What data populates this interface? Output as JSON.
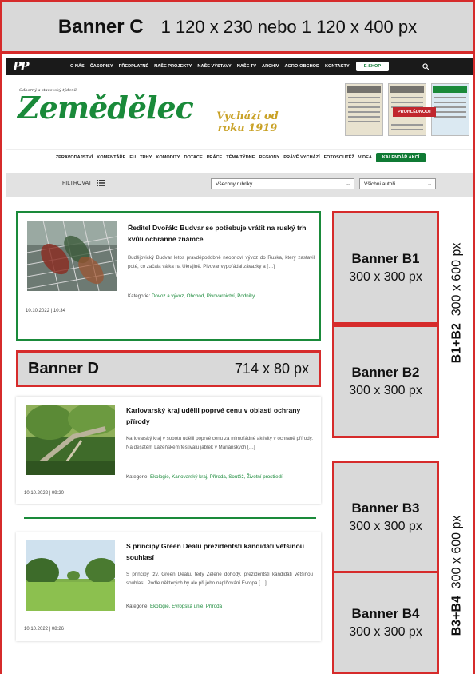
{
  "banners": {
    "c": {
      "name": "Banner C",
      "size": "1 120 x 230 nebo 1 120 x 400 px"
    },
    "d": {
      "name": "Banner D",
      "size": "714 x 80 px"
    },
    "b1": {
      "name": "Banner B1",
      "size": "300 x 300 px"
    },
    "b2": {
      "name": "Banner B2",
      "size": "300 x 300 px"
    },
    "b3": {
      "name": "Banner B3",
      "size": "300 x 300 px"
    },
    "b4": {
      "name": "Banner B4",
      "size": "300 x 300 px"
    },
    "b12_label": {
      "name": "B1+B2",
      "size": "300 x 600 px"
    },
    "b34_label": {
      "name": "B3+B4",
      "size": "300 x 600 px"
    }
  },
  "topbar": {
    "logo": "PP",
    "nav": [
      "O NÁS",
      "ČASOPISY",
      "PŘEDPLATNÉ",
      "NAŠE PROJEKTY",
      "NAŠE VÝSTAVY",
      "NAŠE TV",
      "ARCHIV",
      "AGRO-OBCHOD",
      "KONTAKTY"
    ],
    "eshop": "E-SHOP"
  },
  "header": {
    "tagline": "Odborný a stavovský týdeník",
    "brand": "Zemědělec",
    "since": "Vychází od roku 1919",
    "prohlednout": "PROHLÉDNOUT"
  },
  "mainnav": {
    "items": [
      "ZPRAVODAJSTVÍ",
      "KOMENTÁŘE",
      "EU",
      "TRHY",
      "KOMODITY",
      "DOTACE",
      "PRÁCE",
      "TÉMA TÝDNE",
      "REGIONY",
      "PRÁVĚ VYCHÁZÍ",
      "FOTOSOUTĚŽ",
      "VIDEA"
    ],
    "calendar": "KALENDÁŘ AKCÍ"
  },
  "filter": {
    "label": "FILTROVAT",
    "rubriky": "Všechny rubriky",
    "autori": "Všichni autoři"
  },
  "articles": [
    {
      "title": "Ředitel Dvořák: Budvar se potřebuje vrátit na ruský trh kvůli ochranné známce",
      "perex": "Budějovický Budvar letos pravděpodobně neobnoví vývoz do Ruska, který zastavil poté, co začala válka na Ukrajině. Pivovar vypořádal závazky a […]",
      "cat_label": "Kategorie:",
      "categories": "Dovoz a vývoz, Obchod, Pivovarnictví, Podniky",
      "date": "10.10.2022 | 10:34"
    },
    {
      "title": "Karlovarský kraj udělil poprvé cenu v oblasti ochrany přírody",
      "perex": "Karlovarský kraj v sobotu udělil poprvé cenu za mimořádné aktivity v ochraně přírody. Na desátém Lázeňském festivalu jablek v Mariánských […]",
      "cat_label": "Kategorie:",
      "categories": "Ekologie, Karlovarský kraj, Příroda, Soutěž, Životní prostředí",
      "date": "10.10.2022 | 09:20"
    },
    {
      "title": "S principy Green Dealu prezidentští kandidáti většinou souhlasí",
      "perex": "S principy tzv. Green Dealu, tedy Zelené dohody, prezidentští kandidáti většinou souhlasí. Podle některých by ale při jeho naplňování Evropa […]",
      "cat_label": "Kategorie:",
      "categories": "Ekologie, Evropská unie, Příroda",
      "date": "10.10.2022 | 08:26"
    }
  ],
  "colors": {
    "accent": "#1a8a3a",
    "banner_border": "#d62b2b",
    "banner_fill": "#d9d9d9"
  }
}
